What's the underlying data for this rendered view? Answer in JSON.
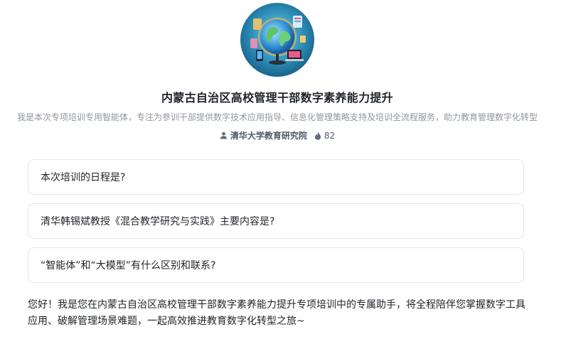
{
  "agent": {
    "title": "内蒙古自治区高校管理干部数字素养能力提升",
    "description": "我是本次专项培训专用智能体，专注为参训干部提供数字技术应用指导、信息化管理策略支持及培训全流程服务，助力教育管理数字化转型",
    "organization": "清华大学教育研究院",
    "count": "82",
    "avatar_icon": "globe-icon"
  },
  "suggestions": [
    {
      "label": "本次培训的日程是?"
    },
    {
      "label": "清华韩锡斌教授《混合教学研究与实践》主要内容是?"
    },
    {
      "label": "“智能体”和“大模型”有什么区别和联系?"
    }
  ],
  "greeting": "您好！我是您在内蒙古自治区高校管理干部数字素养能力提升专项培训中的专属助手，将全程陪伴您掌握数字工具应用、破解管理场景难题，一起高效推进教育数字化转型之旅~",
  "colors": {
    "border": "#e5e6eb",
    "muted_text": "#8f959e",
    "avatar_bg": "#1f6f9a"
  }
}
